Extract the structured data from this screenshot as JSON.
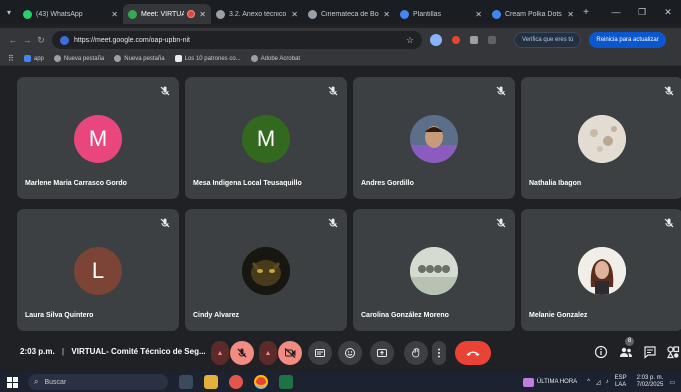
{
  "browser": {
    "tabs": [
      {
        "title": "(43) WhatsApp",
        "color": "#25d366",
        "active": false
      },
      {
        "title": "Meet: VIRTUAL - C",
        "color": "#34a853",
        "active": true,
        "recording": true
      },
      {
        "title": "3.2. Anexo técnico Fo",
        "color": "#9aa0a6",
        "active": false
      },
      {
        "title": "Cinemateca de Bogo",
        "color": "#9aa0a6",
        "active": false
      },
      {
        "title": "Plantillas",
        "color": "#4285f4",
        "active": false
      },
      {
        "title": "Cream Polka Dots Ill",
        "color": "#4285f4",
        "active": false
      }
    ],
    "url": "https://meet.google.com/oap-upbn-nit",
    "verify_label": "Verifica que eres tú",
    "update_label": "Reinicia para actualizar",
    "bookmarks": [
      "app",
      "Nueva pestaña",
      "Nueva pestaña",
      "Los 10 patrones co...",
      "Adobe Acrobat"
    ]
  },
  "participants": [
    {
      "name": "Marlene Maria Carrasco Gordo",
      "initial": "M",
      "color": "#e8467c",
      "photo": false
    },
    {
      "name": "Mesa Indigena Local Teusaquillo",
      "initial": "M",
      "color": "#33691e",
      "photo": false
    },
    {
      "name": "Andres Gordillo",
      "initial": "",
      "color": "#6a4fa0",
      "photo": true
    },
    {
      "name": "Nathalia Ibagon",
      "initial": "",
      "color": "#d9d2c5",
      "photo": true
    },
    {
      "name": "Laura Silva Quintero",
      "initial": "L",
      "color": "#7b4437",
      "photo": false
    },
    {
      "name": "Cindy Alvarez",
      "initial": "",
      "color": "#1b1a14",
      "photo": true
    },
    {
      "name": "Carolina González Moreno",
      "initial": "",
      "color": "#c9d1c4",
      "photo": true
    },
    {
      "name": "Melanie Gonzalez",
      "initial": "",
      "color": "#f1ede8",
      "photo": true
    }
  ],
  "meeting": {
    "time": "2:03 p.m.",
    "title": "VIRTUAL- Comité Técnico de Seg...",
    "participant_count": "8"
  },
  "taskbar": {
    "search_placeholder": "Buscar",
    "news": "ÚLTIMA HORA",
    "lang_top": "ESP",
    "lang_bottom": "LAA",
    "clock_time": "2:03 p. m.",
    "clock_date": "7/02/2025"
  },
  "colors": {
    "accent_red": "#ea4335",
    "mic_off_bg": "#f28b82",
    "tile_bg": "#3c4043"
  }
}
